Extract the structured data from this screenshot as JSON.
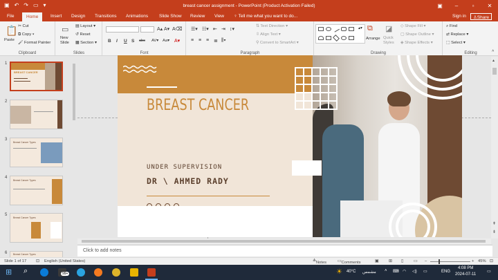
{
  "window": {
    "title": "breast cancer assignment - PowerPoint (Product Activation Failed)"
  },
  "tabs": [
    "File",
    "Home",
    "Insert",
    "Design",
    "Transitions",
    "Animations",
    "Slide Show",
    "Review",
    "View"
  ],
  "tell_me": "Tell me what you want to do...",
  "sign_in": "Sign in",
  "share": "Share",
  "clipboard": {
    "paste": "Paste",
    "cut": "Cut",
    "copy": "Copy",
    "format_painter": "Format Painter",
    "label": "Clipboard"
  },
  "slides_grp": {
    "new_slide": "New Slide",
    "layout": "Layout",
    "reset": "Reset",
    "section": "Section",
    "label": "Slides"
  },
  "font_grp": {
    "label": "Font",
    "bold": "B",
    "italic": "I",
    "underline": "U",
    "shadow": "S",
    "strike": "abc"
  },
  "paragraph_grp": {
    "label": "Paragraph",
    "text_direction": "Text Direction",
    "align_text": "Align Text",
    "convert": "Convert to SmartArt"
  },
  "drawing_grp": {
    "label": "Drawing",
    "arrange": "Arrange",
    "quick_styles": "Quick Styles",
    "fill": "Shape Fill",
    "outline": "Shape Outline",
    "effects": "Shape Effects"
  },
  "editing_grp": {
    "label": "Editing",
    "find": "Find",
    "replace": "Replace",
    "select": "Select"
  },
  "thumb_numbers": [
    "1",
    "2",
    "3",
    "4",
    "5",
    "6"
  ],
  "thumb_titles": [
    "BREAST CANCER",
    "",
    "Breast Cancer Types",
    "Breast Cancer Types",
    "Breast Cancer Types",
    "Breast Cancer Types"
  ],
  "slide": {
    "title": "BREAST CANCER",
    "line1": "UNDER SUPERVISION",
    "line2": "DR \\ AHMED RADY",
    "accent": "#c8893a",
    "brown": "#6e4a33",
    "bg": "#f1e5d8"
  },
  "notes_placeholder": "Click to add notes",
  "status": {
    "slide": "Slide 1 of 17",
    "lang": "English (United States)",
    "notes": "Notes",
    "comments": "Comments",
    "zoom": "45%"
  },
  "taskbar": {
    "badge": "99+",
    "weather": "40°C",
    "weather_desc": "مشمس",
    "lang": "ENG",
    "time": "4:08 PM",
    "date": "2024-07-11"
  }
}
